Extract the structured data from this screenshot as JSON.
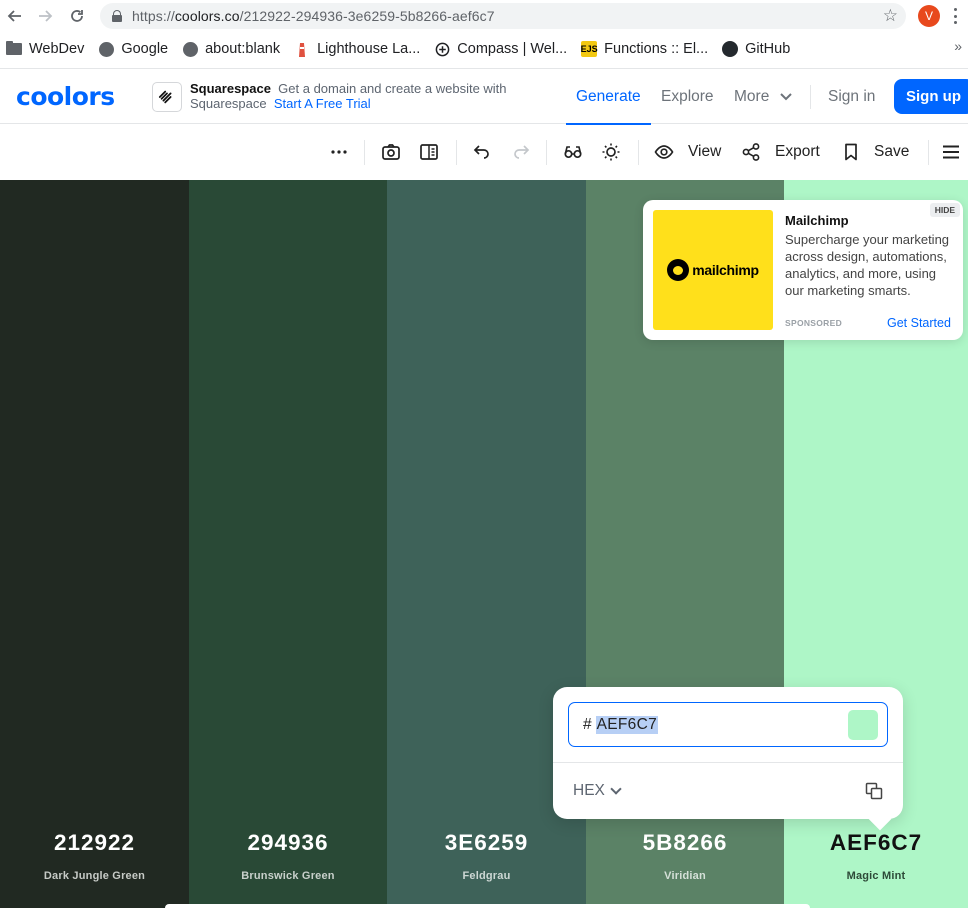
{
  "browser": {
    "url_scheme": "https://",
    "url_host": "coolors.co",
    "url_path": "/212922-294936-3e6259-5b8266-aef6c7",
    "profile_initial": "V",
    "bookmarks": [
      {
        "label": "WebDev",
        "icon": "folder-icon"
      },
      {
        "label": "Google",
        "icon": "globe-icon"
      },
      {
        "label": "about:blank",
        "icon": "globe-icon"
      },
      {
        "label": "Lighthouse La...",
        "icon": "lighthouse-icon"
      },
      {
        "label": "Compass | Wel...",
        "icon": "compass-icon"
      },
      {
        "label": "Functions :: El...",
        "icon": "ejs-icon"
      },
      {
        "label": "GitHub",
        "icon": "github-icon"
      }
    ]
  },
  "header": {
    "logo": "coolors",
    "sponsor_name": "Squarespace",
    "sponsor_text_1": "Get a domain and create a website with",
    "sponsor_text_2": "Squarespace",
    "sponsor_cta": "Start A Free Trial",
    "nav": {
      "generate": "Generate",
      "explore": "Explore",
      "more": "More",
      "sign_in": "Sign in",
      "sign_up": "Sign up"
    },
    "accent_color": "#0066ff"
  },
  "toolbar": {
    "view": "View",
    "export": "Export",
    "save": "Save"
  },
  "palette": [
    {
      "hex": "212922",
      "name": "Dark Jungle Green",
      "color": "#212922",
      "text_color": "#ffffff",
      "name_color": "#c6cac6"
    },
    {
      "hex": "294936",
      "name": "Brunswick Green",
      "color": "#294936",
      "text_color": "#ffffff",
      "name_color": "#c8d0cb"
    },
    {
      "hex": "3E6259",
      "name": "Feldgrau",
      "color": "#3e6259",
      "text_color": "#ffffff",
      "name_color": "#cdd7d4"
    },
    {
      "hex": "5B8266",
      "name": "Viridian",
      "color": "#5b8266",
      "text_color": "#ffffff",
      "name_color": "#d5e0d8"
    },
    {
      "hex": "AEF6C7",
      "name": "Magic Mint",
      "color": "#aef6c7",
      "text_color": "#111111",
      "name_color": "#2d4a38"
    }
  ],
  "ad": {
    "brand_word": "mailchimp",
    "title": "Mailchimp",
    "body": "Supercharge your marketing across design, automations, analytics, and more, using our marketing smarts.",
    "sponsored": "SPONSORED",
    "cta": "Get Started",
    "hide": "HIDE"
  },
  "picker": {
    "hash": "#",
    "value": "AEF6C7",
    "chip_color": "#aef6c7",
    "mode": "HEX"
  }
}
